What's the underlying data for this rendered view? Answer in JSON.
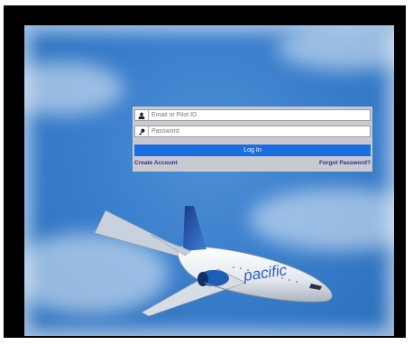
{
  "login": {
    "email_placeholder": "Email or Pilot ID",
    "password_placeholder": "Password",
    "login_button": "Log In",
    "create_account": "Create Account",
    "forgot_password": "Forgot Password?"
  },
  "aircraft": {
    "livery_text": "pacific"
  },
  "icons": {
    "user": "user-icon",
    "key": "key-icon"
  },
  "colors": {
    "sky": "#3a7fcc",
    "login_button": "#1a6fe0",
    "panel": "#c9c9d0",
    "links": "#3b2a8e"
  }
}
